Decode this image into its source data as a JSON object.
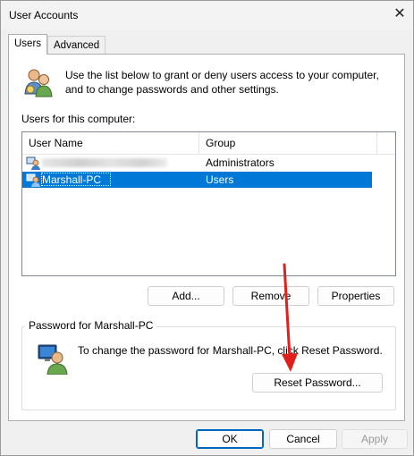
{
  "window": {
    "title": "User Accounts",
    "close_glyph": "✕"
  },
  "tabs": [
    {
      "label": "Users",
      "active": true
    },
    {
      "label": "Advanced",
      "active": false
    }
  ],
  "intro": {
    "text": "Use the list below to grant or deny users access to your computer, and to change passwords and other settings.",
    "icon": "users-icon"
  },
  "users_list": {
    "label": "Users for this computer:",
    "columns": [
      "User Name",
      "Group"
    ],
    "rows": [
      {
        "user": "",
        "group": "Administrators",
        "selected": false
      },
      {
        "user": "Marshall-PC",
        "group": "Users",
        "selected": true
      }
    ]
  },
  "list_buttons": {
    "add": "Add...",
    "remove": "Remove",
    "properties": "Properties"
  },
  "password_group": {
    "title": "Password for Marshall-PC",
    "text": "To change the password for Marshall-PC, click Reset Password.",
    "reset_button": "Reset Password..."
  },
  "dialog_buttons": {
    "ok": "OK",
    "cancel": "Cancel",
    "apply": "Apply"
  },
  "colors": {
    "selection": "#0078d7",
    "annotation_arrow": "#e0201c",
    "default_button_border": "#0067c0"
  }
}
